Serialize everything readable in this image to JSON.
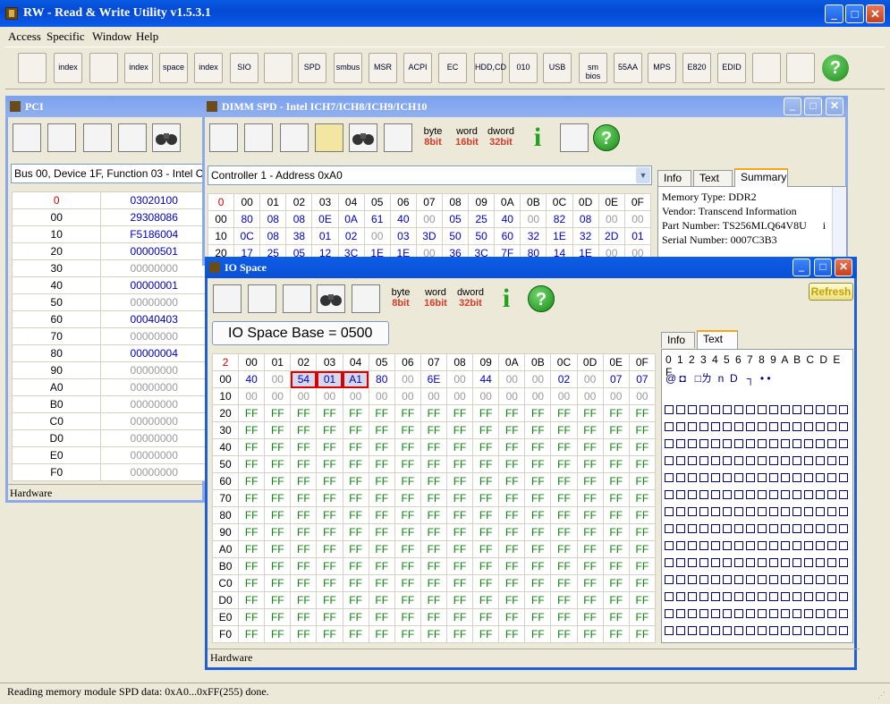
{
  "app": {
    "title": "RW - Read & Write Utility v1.5.3.1"
  },
  "menu": [
    "Access",
    "Specific",
    "Window",
    "Help"
  ],
  "toolbar_icons": [
    "pci-icon",
    "pci-index-icon",
    "memory-icon",
    "memory-index-icon",
    "io-space-icon",
    "io-index-icon",
    "sio-icon",
    "waveform-icon",
    "spd-icon",
    "smbus-icon",
    "msr-icon",
    "acpi-icon",
    "ec-icon",
    "hdd-cd-icon",
    "cmos-icon",
    "usb-icon",
    "smbios-icon",
    "55aa-icon",
    "mps-icon",
    "e820-icon",
    "edid-icon",
    "command-icon",
    "battery-icon",
    "help-icon"
  ],
  "toolbar_labels": [
    "",
    "index",
    "",
    "index",
    "space",
    "index",
    "SIO",
    "",
    "SPD",
    "smbus",
    "MSR",
    "ACPI",
    "EC",
    "HDD,CD",
    "010",
    "USB",
    "sm bios",
    "55AA",
    "MPS",
    "E820",
    "EDID",
    "",
    "",
    ""
  ],
  "pci": {
    "title": "PCI",
    "device": "Bus 00, Device 1F, Function 03 - Intel C",
    "header": [
      "0",
      "03020100"
    ],
    "rows": [
      [
        "00",
        "29308086"
      ],
      [
        "10",
        "F5186004"
      ],
      [
        "20",
        "00000501"
      ],
      [
        "30",
        "00000000"
      ],
      [
        "40",
        "00000001"
      ],
      [
        "50",
        "00000000"
      ],
      [
        "60",
        "00040403"
      ],
      [
        "70",
        "00000000"
      ],
      [
        "80",
        "00000004"
      ],
      [
        "90",
        "00000000"
      ],
      [
        "A0",
        "00000000"
      ],
      [
        "B0",
        "00000000"
      ],
      [
        "C0",
        "00000000"
      ],
      [
        "D0",
        "00000000"
      ],
      [
        "E0",
        "00000000"
      ],
      [
        "F0",
        "00000000"
      ]
    ],
    "status": "Hardware"
  },
  "spd": {
    "title": "DIMM SPD - Intel ICH7/ICH8/ICH9/ICH10",
    "controller": "Controller 1 - Address 0xA0",
    "header": [
      "0",
      "00",
      "01",
      "02",
      "03",
      "04",
      "05",
      "06",
      "07",
      "08",
      "09",
      "0A",
      "0B",
      "0C",
      "0D",
      "0E",
      "0F"
    ],
    "rows": [
      [
        "00",
        "80",
        "08",
        "08",
        "0E",
        "0A",
        "61",
        "40",
        "00",
        "05",
        "25",
        "40",
        "00",
        "82",
        "08",
        "00",
        "00"
      ],
      [
        "10",
        "0C",
        "08",
        "38",
        "01",
        "02",
        "00",
        "03",
        "3D",
        "50",
        "50",
        "60",
        "32",
        "1E",
        "32",
        "2D",
        "01"
      ],
      [
        "20",
        "17",
        "25",
        "05",
        "12",
        "3C",
        "1E",
        "1E",
        "00",
        "36",
        "3C",
        "7F",
        "80",
        "14",
        "1E",
        "00",
        "00"
      ]
    ],
    "tabs": [
      "Info",
      "Text",
      "Summary"
    ],
    "active_tab": "Summary",
    "summary": [
      "Memory Type: DDR2",
      "Vendor: Transcend Information",
      "Part Number: TS256MLQ64V8U      i",
      "Serial Number: 0007C3B3"
    ],
    "bit_buttons": [
      [
        "byte",
        "8bit"
      ],
      [
        "word",
        "16bit"
      ],
      [
        "dword",
        "32bit"
      ]
    ]
  },
  "io": {
    "title": "IO Space",
    "base": "IO Space Base = 0500",
    "refresh": "Refresh",
    "tabs": [
      "Info",
      "Text"
    ],
    "active_tab": "Text",
    "header": [
      "2",
      "00",
      "01",
      "02",
      "03",
      "04",
      "05",
      "06",
      "07",
      "08",
      "09",
      "0A",
      "0B",
      "0C",
      "0D",
      "0E",
      "0F"
    ],
    "rows": [
      [
        "00",
        "40",
        "00",
        "54",
        "01",
        "A1",
        "80",
        "00",
        "6E",
        "00",
        "44",
        "00",
        "00",
        "02",
        "00",
        "07",
        "07"
      ],
      [
        "10",
        "00",
        "00",
        "00",
        "00",
        "00",
        "00",
        "00",
        "00",
        "00",
        "00",
        "00",
        "00",
        "00",
        "00",
        "00",
        "00"
      ],
      [
        "20",
        "FF",
        "FF",
        "FF",
        "FF",
        "FF",
        "FF",
        "FF",
        "FF",
        "FF",
        "FF",
        "FF",
        "FF",
        "FF",
        "FF",
        "FF",
        "FF"
      ],
      [
        "30",
        "FF",
        "FF",
        "FF",
        "FF",
        "FF",
        "FF",
        "FF",
        "FF",
        "FF",
        "FF",
        "FF",
        "FF",
        "FF",
        "FF",
        "FF",
        "FF"
      ],
      [
        "40",
        "FF",
        "FF",
        "FF",
        "FF",
        "FF",
        "FF",
        "FF",
        "FF",
        "FF",
        "FF",
        "FF",
        "FF",
        "FF",
        "FF",
        "FF",
        "FF"
      ],
      [
        "50",
        "FF",
        "FF",
        "FF",
        "FF",
        "FF",
        "FF",
        "FF",
        "FF",
        "FF",
        "FF",
        "FF",
        "FF",
        "FF",
        "FF",
        "FF",
        "FF"
      ],
      [
        "60",
        "FF",
        "FF",
        "FF",
        "FF",
        "FF",
        "FF",
        "FF",
        "FF",
        "FF",
        "FF",
        "FF",
        "FF",
        "FF",
        "FF",
        "FF",
        "FF"
      ],
      [
        "70",
        "FF",
        "FF",
        "FF",
        "FF",
        "FF",
        "FF",
        "FF",
        "FF",
        "FF",
        "FF",
        "FF",
        "FF",
        "FF",
        "FF",
        "FF",
        "FF"
      ],
      [
        "80",
        "FF",
        "FF",
        "FF",
        "FF",
        "FF",
        "FF",
        "FF",
        "FF",
        "FF",
        "FF",
        "FF",
        "FF",
        "FF",
        "FF",
        "FF",
        "FF"
      ],
      [
        "90",
        "FF",
        "FF",
        "FF",
        "FF",
        "FF",
        "FF",
        "FF",
        "FF",
        "FF",
        "FF",
        "FF",
        "FF",
        "FF",
        "FF",
        "FF",
        "FF"
      ],
      [
        "A0",
        "FF",
        "FF",
        "FF",
        "FF",
        "FF",
        "FF",
        "FF",
        "FF",
        "FF",
        "FF",
        "FF",
        "FF",
        "FF",
        "FF",
        "FF",
        "FF"
      ],
      [
        "B0",
        "FF",
        "FF",
        "FF",
        "FF",
        "FF",
        "FF",
        "FF",
        "FF",
        "FF",
        "FF",
        "FF",
        "FF",
        "FF",
        "FF",
        "FF",
        "FF"
      ],
      [
        "C0",
        "FF",
        "FF",
        "FF",
        "FF",
        "FF",
        "FF",
        "FF",
        "FF",
        "FF",
        "FF",
        "FF",
        "FF",
        "FF",
        "FF",
        "FF",
        "FF"
      ],
      [
        "D0",
        "FF",
        "FF",
        "FF",
        "FF",
        "FF",
        "FF",
        "FF",
        "FF",
        "FF",
        "FF",
        "FF",
        "FF",
        "FF",
        "FF",
        "FF",
        "FF"
      ],
      [
        "E0",
        "FF",
        "FF",
        "FF",
        "FF",
        "FF",
        "FF",
        "FF",
        "FF",
        "FF",
        "FF",
        "FF",
        "FF",
        "FF",
        "FF",
        "FF",
        "FF"
      ],
      [
        "F0",
        "FF",
        "FF",
        "FF",
        "FF",
        "FF",
        "FF",
        "FF",
        "FF",
        "FF",
        "FF",
        "FF",
        "FF",
        "FF",
        "FF",
        "FF",
        "FF"
      ]
    ],
    "selected": [
      "54",
      "01",
      "A1"
    ],
    "text_header": "0 1 2 3 4 5 6 7 8 9 A B C D E F",
    "text_row0": "@ ◘   □ㄌ  n  D   ┐  • •",
    "status": "Hardware"
  },
  "status_bar": "Reading memory module SPD data: 0xA0...0xFF(255) done.",
  "colors": {
    "title_active": "#0b4fd8",
    "title_inactive": "#8ca9ea",
    "hex_red": "#d00000",
    "hex_blue": "#0000c0",
    "hex_green": "#108010"
  }
}
